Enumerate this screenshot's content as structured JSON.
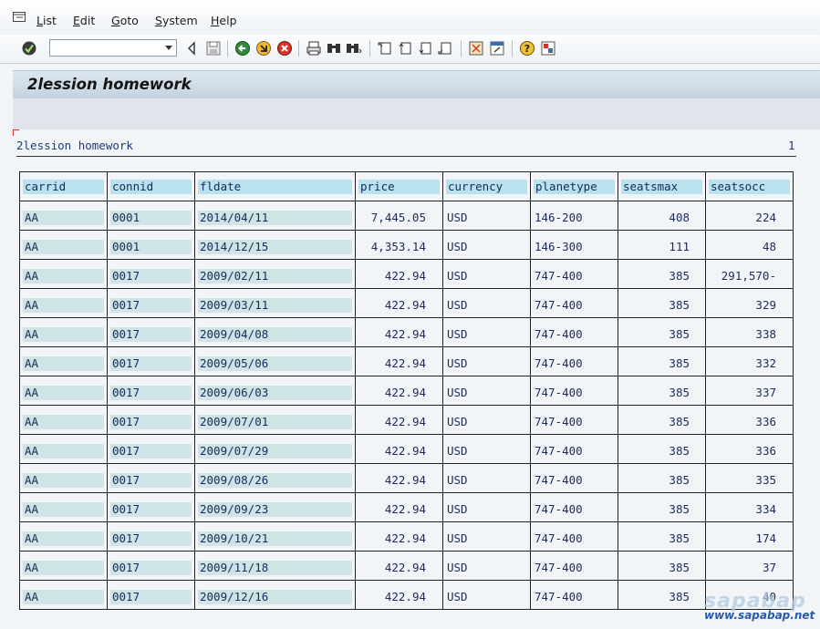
{
  "menu": {
    "items": [
      "List",
      "Edit",
      "Goto",
      "System",
      "Help"
    ]
  },
  "toolbar": {
    "command_field_value": "",
    "icons": [
      "enter-icon",
      "back-triangle-icon",
      "save-icon",
      "back-icon",
      "exit-icon",
      "cancel-icon",
      "print-icon",
      "find-icon",
      "find-next-icon",
      "first-page-icon",
      "previous-page-icon",
      "next-page-icon",
      "last-page-icon",
      "create-session-icon",
      "shortcut-icon",
      "help-icon",
      "layout-icon"
    ]
  },
  "screen": {
    "title": "2lession homework"
  },
  "list": {
    "title": "2lession homework",
    "page": "1",
    "columns": [
      "carrid",
      "connid",
      "fldate",
      "price",
      "currency",
      "planetype",
      "seatsmax",
      "seatsocc"
    ],
    "rows": [
      [
        "AA",
        "0001",
        "2014/04/11",
        "7,445.05",
        "USD",
        "146-200",
        "408",
        "224"
      ],
      [
        "AA",
        "0001",
        "2014/12/15",
        "4,353.14",
        "USD",
        "146-300",
        "111",
        "48"
      ],
      [
        "AA",
        "0017",
        "2009/02/11",
        "422.94",
        "USD",
        "747-400",
        "385",
        "291,570-"
      ],
      [
        "AA",
        "0017",
        "2009/03/11",
        "422.94",
        "USD",
        "747-400",
        "385",
        "329"
      ],
      [
        "AA",
        "0017",
        "2009/04/08",
        "422.94",
        "USD",
        "747-400",
        "385",
        "338"
      ],
      [
        "AA",
        "0017",
        "2009/05/06",
        "422.94",
        "USD",
        "747-400",
        "385",
        "332"
      ],
      [
        "AA",
        "0017",
        "2009/06/03",
        "422.94",
        "USD",
        "747-400",
        "385",
        "337"
      ],
      [
        "AA",
        "0017",
        "2009/07/01",
        "422.94",
        "USD",
        "747-400",
        "385",
        "336"
      ],
      [
        "AA",
        "0017",
        "2009/07/29",
        "422.94",
        "USD",
        "747-400",
        "385",
        "336"
      ],
      [
        "AA",
        "0017",
        "2009/08/26",
        "422.94",
        "USD",
        "747-400",
        "385",
        "335"
      ],
      [
        "AA",
        "0017",
        "2009/09/23",
        "422.94",
        "USD",
        "747-400",
        "385",
        "334"
      ],
      [
        "AA",
        "0017",
        "2009/10/21",
        "422.94",
        "USD",
        "747-400",
        "385",
        "174"
      ],
      [
        "AA",
        "0017",
        "2009/11/18",
        "422.94",
        "USD",
        "747-400",
        "385",
        "37"
      ],
      [
        "AA",
        "0017",
        "2009/12/16",
        "422.94",
        "USD",
        "747-400",
        "385",
        "40"
      ]
    ]
  },
  "watermark": {
    "brand": "sapabap",
    "url": "www.sapabap.net"
  }
}
